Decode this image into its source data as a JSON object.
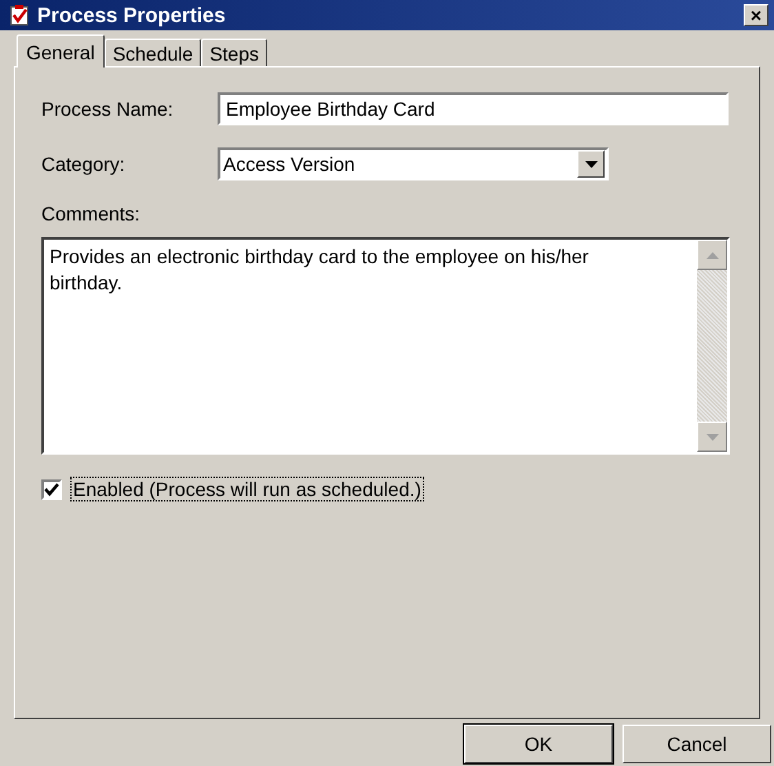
{
  "window": {
    "title": "Process Properties",
    "close": "×"
  },
  "tabs": [
    {
      "label": "General",
      "selected": true
    },
    {
      "label": "Schedule",
      "selected": false
    },
    {
      "label": "Steps",
      "selected": false
    }
  ],
  "process_name": {
    "label": "Process Name:",
    "value": "Employee Birthday Card"
  },
  "category": {
    "label": "Category:",
    "value": "Access Version"
  },
  "comments": {
    "label": "Comments:",
    "value": "Provides an electronic birthday card to the employee on his/her birthday."
  },
  "enabled": {
    "label": "Enabled (Process will run as scheduled.)",
    "checked": true
  },
  "buttons": [
    {
      "label": "OK",
      "default": true
    },
    {
      "label": "Cancel",
      "default": false
    }
  ]
}
